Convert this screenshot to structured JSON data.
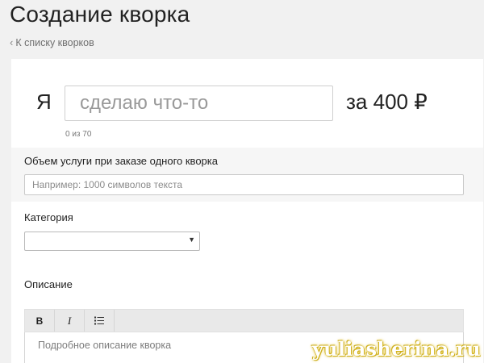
{
  "header": {
    "title": "Создание кворка",
    "back_link": "К списку кворков"
  },
  "kwork_title": {
    "prefix": "Я",
    "placeholder": "сделаю что-то",
    "price": "за 400 ₽",
    "counter": "0 из 70"
  },
  "volume": {
    "label": "Объем услуги при заказе одного кворка",
    "placeholder": "Например: 1000 символов текста"
  },
  "category": {
    "label": "Категория",
    "selected": ""
  },
  "description": {
    "label": "Описание",
    "toolbar": {
      "bold": "B",
      "italic": "I"
    },
    "placeholder": "Подробное описание кворка"
  },
  "watermark": "yuliasherina.ru",
  "colors": {
    "background": "#f1f1f1",
    "card": "#ffffff",
    "band": "#f6f6f6",
    "toolbar": "#e9e9e9"
  },
  "icons": {
    "back": "chevron-left-icon",
    "dropdown": "caret-down-icon",
    "list": "bulleted-list-icon"
  }
}
